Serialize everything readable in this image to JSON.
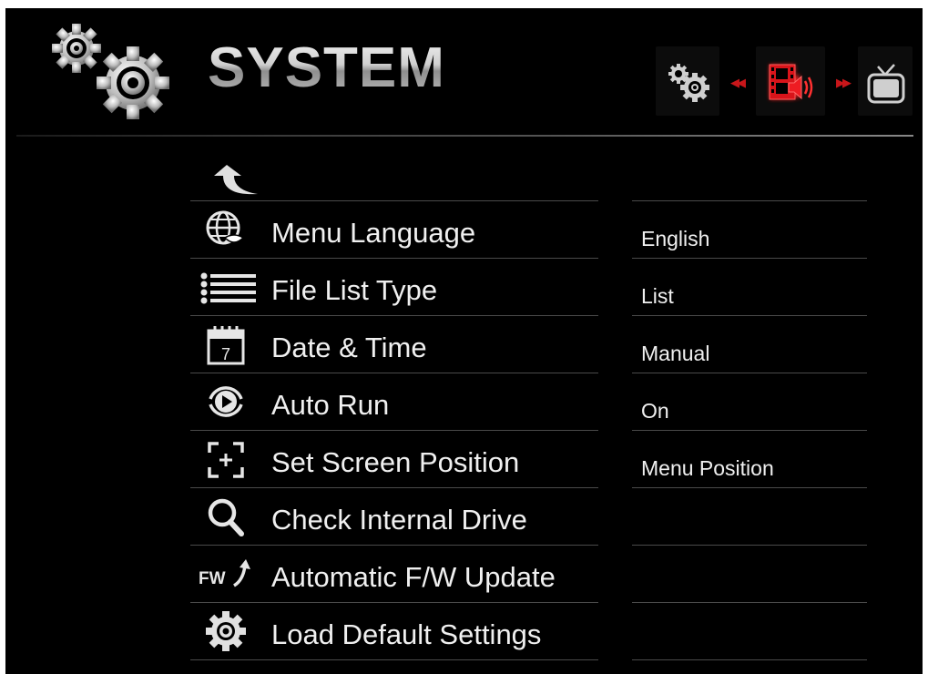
{
  "header": {
    "title": "SYSTEM",
    "icon": "gears-icon"
  },
  "mode_bar": {
    "items": [
      {
        "name": "settings",
        "icon": "gears-icon",
        "active": false
      },
      {
        "name": "movie",
        "icon": "film-speaker-icon",
        "active": true
      },
      {
        "name": "tv",
        "icon": "tv-icon",
        "active": false
      }
    ],
    "arrow_color": "#c8161a"
  },
  "back": {
    "icon": "back-arrow-icon"
  },
  "menu": {
    "items": [
      {
        "label": "Menu Language",
        "value": "English",
        "icon": "globe-icon"
      },
      {
        "label": "File List Type",
        "value": "List",
        "icon": "list-icon"
      },
      {
        "label": "Date & Time",
        "value": "Manual",
        "icon": "calendar-icon"
      },
      {
        "label": "Auto Run",
        "value": "On",
        "icon": "autorun-icon"
      },
      {
        "label": "Set Screen Position",
        "value": "Menu Position",
        "icon": "screen-position-icon"
      },
      {
        "label": "Check Internal Drive",
        "value": "",
        "icon": "magnifier-icon"
      },
      {
        "label": "Automatic F/W Update",
        "value": "",
        "icon": "fw-update-icon"
      },
      {
        "label": "Load Default Settings",
        "value": "",
        "icon": "gear-icon"
      }
    ],
    "fw_icon_text": "FW",
    "calendar_icon_text": "7"
  }
}
